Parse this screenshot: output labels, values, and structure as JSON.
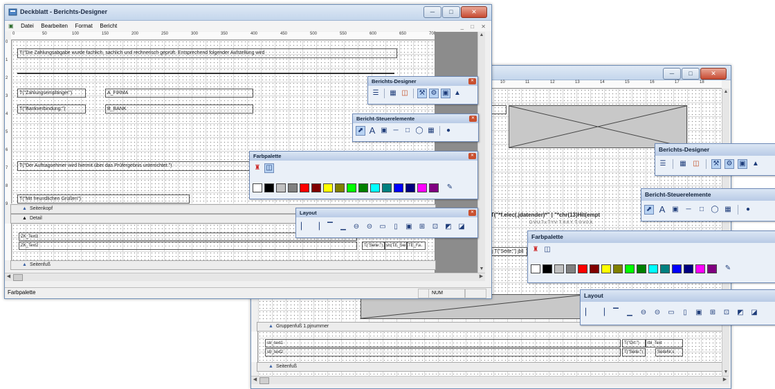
{
  "window1": {
    "title": "Deckblatt - Berichts-Designer",
    "menu": [
      "Datei",
      "Bearbeiten",
      "Format",
      "Bericht"
    ],
    "ruler_labels": [
      "0",
      "50",
      "100",
      "150",
      "200",
      "250",
      "300",
      "350",
      "400",
      "450",
      "500",
      "550",
      "600",
      "650",
      "700"
    ],
    "vruler_labels": [
      "0",
      "1",
      "2",
      "3",
      "4",
      "5",
      "6",
      "7",
      "8",
      "9"
    ],
    "fields": {
      "text1": "T(\"Die Zahlungsabgabe wurde fachlich, sachlich und rechnerisch geprüft. Entsprechend folgender Aufstellung wird",
      "label_zahlung": "T(\"Zahlungsempfänger\")",
      "value_firma": "A_FIRMA",
      "label_bank": "T(\"Bankverbindung:\")",
      "value_bank": "B_BANK",
      "text2": "T(\"Der Auftragnehmer wird hiermit über das Prüfergebnis unterrichtet.\")",
      "greeting": "T(\"Mit freundlichen Grüßen\")",
      "det1": "ZK_Text1",
      "det2": "ZK_Text2",
      "f1": "T(\"Seite:\")",
      "f2": "str(TE_Sei",
      "f3": "TE_Fa"
    },
    "bands": {
      "seitenkopf": "Seitenkopf",
      "detail": "Detail",
      "seitenfuss": "Seitenfuß"
    },
    "status": "Farbpalette",
    "num": "NUM"
  },
  "window2": {
    "ruler_labels": [
      "10",
      "11",
      "12",
      "13",
      "14",
      "15",
      "16",
      "17",
      "18"
    ],
    "vruler_labels": [
      "0",
      "1",
      "2",
      "3"
    ],
    "bigformula": "T(\"*f.elec(.jdatender)*\" | \"*chr(13)Hit(empt",
    "subline": "D.V.U.T.x.T.Y.V. T. 0.0.Y. T. 0.V.0.X.",
    "formula2": "j T(\"Seite:\") jbli",
    "fields": {
      "a": "str_text1",
      "b": "str_text2",
      "c": "T(\"Ort:\")",
      "d": "tbl_Text",
      "e": "T(\"Seite:\")",
      "f": "SeiteNr.s"
    },
    "bands": {
      "gruppenfuss": "Gruppenfuß 1.pjnummer",
      "seitenfuss": "Seitenfuß"
    }
  },
  "toolbars": {
    "designer": {
      "title": "Berichts-Designer"
    },
    "controls": {
      "title": "Bericht-Steuerelemente"
    },
    "palette": {
      "title": "Farbpalette"
    },
    "layout": {
      "title": "Layout"
    }
  },
  "palette_colors": [
    "#ffffff",
    "#000000",
    "#c0c0c0",
    "#808080",
    "#ff0000",
    "#800000",
    "#ffff00",
    "#808000",
    "#00ff00",
    "#008000",
    "#00ffff",
    "#008080",
    "#0000ff",
    "#000080",
    "#ff00ff",
    "#800080"
  ],
  "icons": {
    "designer": [
      "list-icon",
      "tree-icon",
      "page-icon",
      "tools-icon",
      "settings-icon",
      "save-icon",
      "preview-icon"
    ],
    "controls": [
      "pointer-icon",
      "text-icon",
      "image-icon",
      "line-icon",
      "rectangle-icon",
      "ellipse-icon",
      "field-icon",
      "lock-icon"
    ],
    "palette": [
      "fill-bucket-icon",
      "copy-icon"
    ],
    "layout": [
      "align-left-icon",
      "align-right-icon",
      "align-top-icon",
      "align-bottom-icon",
      "center-h-icon",
      "center-v-icon",
      "same-width-icon",
      "same-height-icon",
      "same-size-icon",
      "grid-icon",
      "snap-icon",
      "bring-front-icon",
      "send-back-icon"
    ]
  }
}
